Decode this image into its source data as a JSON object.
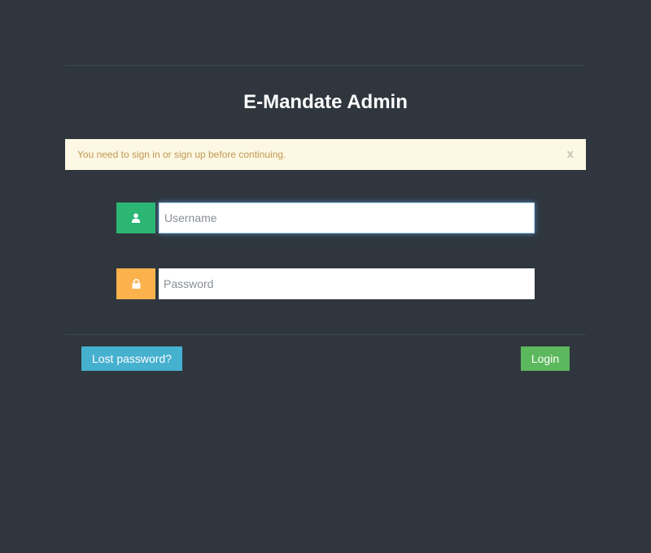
{
  "login": {
    "title": "E-Mandate Admin",
    "alert": {
      "message": "You need to sign in or sign up before continuing.",
      "close_label": "x"
    },
    "username": {
      "placeholder": "Username",
      "value": "",
      "icon": "user-icon"
    },
    "password": {
      "placeholder": "Password",
      "value": "",
      "icon": "lock-icon"
    },
    "lost_password_label": "Lost password?",
    "login_label": "Login"
  },
  "colors": {
    "background": "#2f363e",
    "alert_bg": "#fcf8e3",
    "alert_text": "#c09853",
    "user_addon": "#2bb673",
    "lock_addon": "#fbb24c",
    "lost_button": "#46b0cf",
    "login_button": "#5cb85c"
  }
}
